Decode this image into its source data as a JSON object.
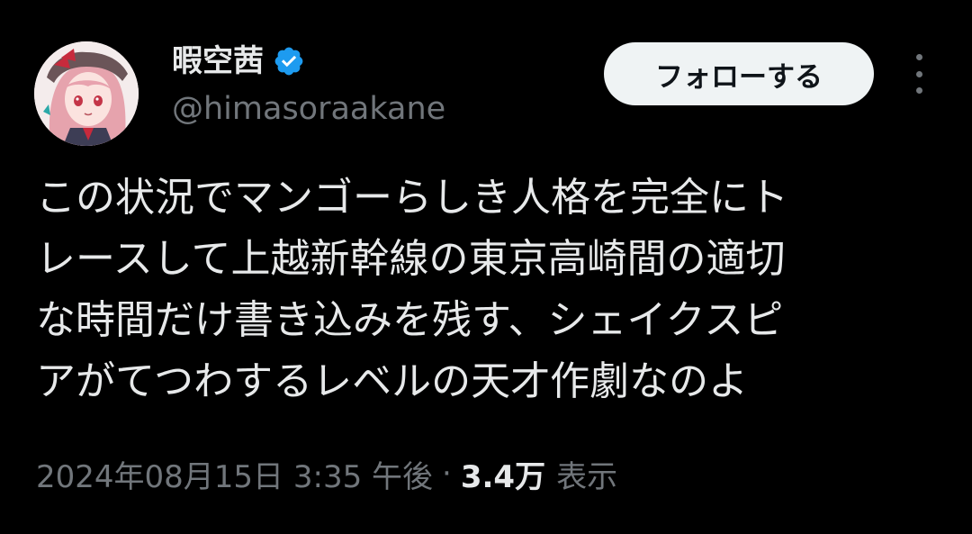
{
  "user": {
    "display_name": "暇空茜",
    "handle": "@himasoraakane",
    "verified": true,
    "avatar_icon": "anime-character-avatar"
  },
  "actions": {
    "follow_label": "フォローする",
    "more_icon": "more-vertical-icon"
  },
  "tweet": {
    "lines": [
      "この状況でマンゴーらしき人格を完全にト",
      "レースして上越新幹線の東京高崎間の適切",
      "な時間だけ書き込みを残す、シェイクスピ",
      "アがてつわするレベルの天才作劇なのよ"
    ]
  },
  "meta": {
    "timestamp": "2024年08月15日 3:35 午後",
    "separator": "·",
    "views_count": "3.4万",
    "views_label": "表示"
  },
  "colors": {
    "background": "#000000",
    "text_primary": "#e7e9ea",
    "text_secondary": "#71767b",
    "verified_blue": "#1d9bf0",
    "button_bg": "#eff3f4",
    "button_text": "#0f1419"
  }
}
